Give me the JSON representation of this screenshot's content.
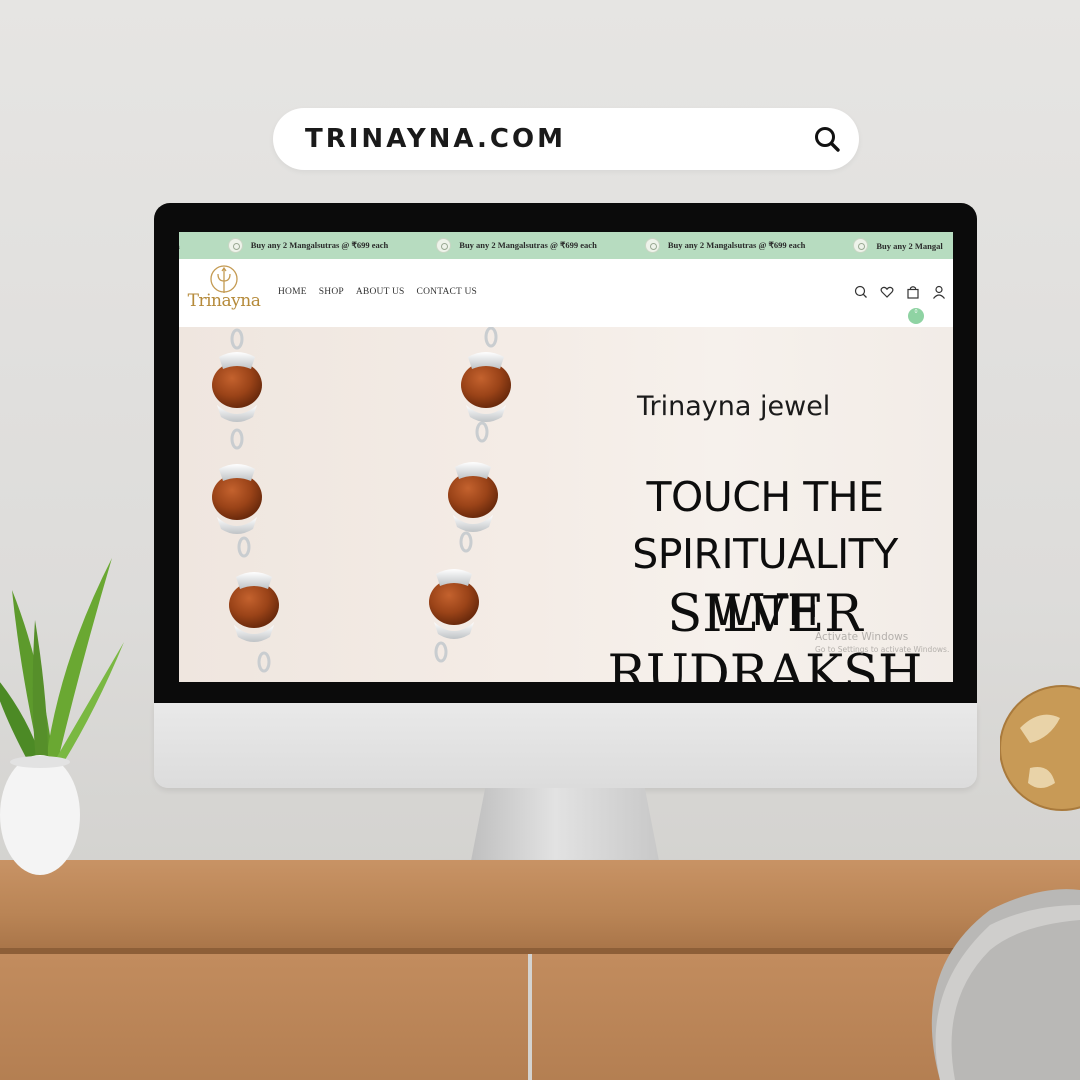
{
  "search_bar": {
    "text": "TRINAYNA.COM",
    "icon": "search-icon"
  },
  "site": {
    "promo_bar": {
      "items": [
        "ach",
        "Buy any 2 Mangalsutras @ ₹699 each",
        "Buy any 2 Mangalsutras @ ₹699 each",
        "Buy any 2 Mangalsutras @ ₹699 each",
        "Buy any 2 Mangal"
      ],
      "background": "#b7dcc0"
    },
    "logo_text": "Trinayna",
    "nav": {
      "items": [
        "HOME",
        "SHOP",
        "ABOUT US",
        "CONTACT US"
      ]
    },
    "nav_icons": [
      "search-icon",
      "heart-icon",
      "cart-icon",
      "user-icon"
    ],
    "cart_count": "0",
    "hero": {
      "subtitle": "Trinayna jewel",
      "heading_line1": "TOUCH THE",
      "heading_line2": "SPIRITUALITY WITH",
      "heading_line3": "SILVER",
      "heading_line4": "RUDRAKSH"
    }
  },
  "windows_watermark": {
    "title": "Activate Windows",
    "subtitle": "Go to Settings to activate Windows."
  },
  "colors": {
    "accent_green": "#b7dcc0",
    "logo_gold": "#b58a3a",
    "hero_bg": "#f3ece6",
    "desk_wood": "#b98455"
  }
}
